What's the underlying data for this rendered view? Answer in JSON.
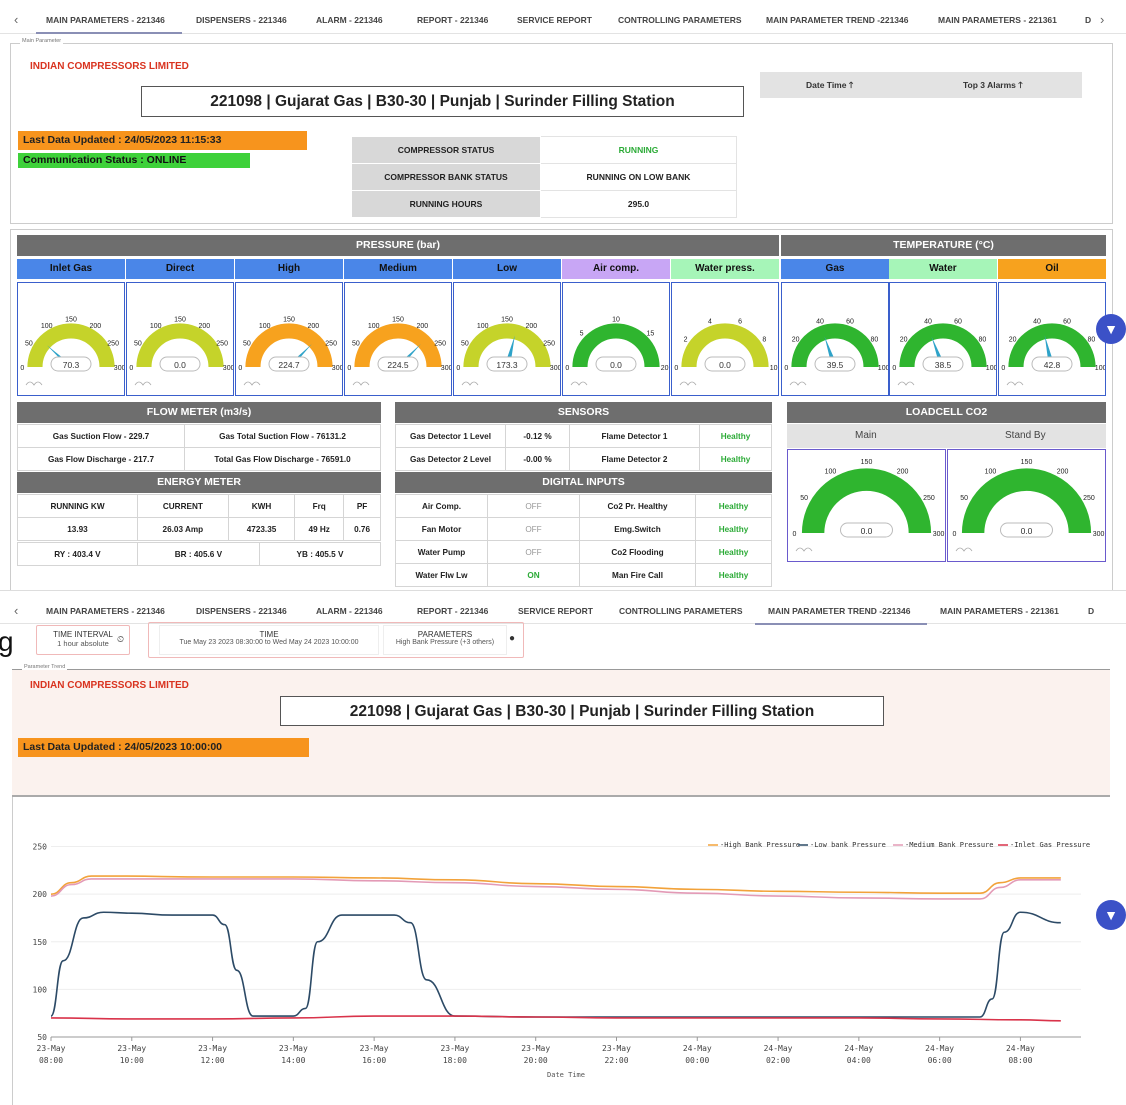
{
  "tabs_top": [
    "MAIN PARAMETERS - 221346",
    "DISPENSERS - 221346",
    "ALARM - 221346",
    "REPORT - 221346",
    "SERVICE REPORT",
    "CONTROLLING PARAMETERS",
    "MAIN PARAMETER TREND -221346",
    "MAIN PARAMETERS - 221361",
    "D"
  ],
  "tabs_bottom": [
    "MAIN PARAMETERS - 221346",
    "DISPENSERS - 221346",
    "ALARM - 221346",
    "REPORT - 221346",
    "SERVICE REPORT",
    "CONTROLLING PARAMETERS",
    "MAIN PARAMETER TREND -221346",
    "MAIN PARAMETERS - 221361",
    "D"
  ],
  "panel1": {
    "panel_label": "Main Parameter",
    "company": "INDIAN COMPRESSORS LIMITED",
    "station": "221098 | Gujarat Gas | B30-30 | Punjab | Surinder Filling Station",
    "last_updated": "Last Data Updated :  24/05/2023 11:15:33",
    "comm_status": "Communication Status : ONLINE",
    "date_time_btn": "Date Time",
    "top_alarms_btn": "Top 3 Alarms",
    "status": [
      {
        "label": "COMPRESSOR STATUS",
        "value": "RUNNING"
      },
      {
        "label": "COMPRESSOR BANK STATUS",
        "value": "RUNNING ON LOW BANK"
      },
      {
        "label": "RUNNING HOURS",
        "value": "295.0"
      }
    ]
  },
  "pressure": {
    "title": "PRESSURE (bar)",
    "gauges": [
      {
        "label": "Inlet Gas",
        "value": "70.3",
        "v": 70.3,
        "min": 0,
        "max": 300,
        "ticks": [
          "0",
          "50",
          "100",
          "150",
          "200",
          "250",
          "300"
        ],
        "color": "#c5d32a",
        "hcolor": "#4a86e8"
      },
      {
        "label": "Direct",
        "value": "0.0",
        "v": 0,
        "min": 0,
        "max": 300,
        "ticks": [
          "0",
          "50",
          "100",
          "150",
          "200",
          "250",
          "300"
        ],
        "color": "#c5d32a",
        "hcolor": "#4a86e8"
      },
      {
        "label": "High",
        "value": "224.7",
        "v": 224.7,
        "min": 0,
        "max": 300,
        "ticks": [
          "0",
          "50",
          "100",
          "150",
          "200",
          "250",
          "300"
        ],
        "color": "#f7a21e",
        "hcolor": "#4a86e8"
      },
      {
        "label": "Medium",
        "value": "224.5",
        "v": 224.5,
        "min": 0,
        "max": 300,
        "ticks": [
          "0",
          "50",
          "100",
          "150",
          "200",
          "250",
          "300"
        ],
        "color": "#f7a21e",
        "hcolor": "#4a86e8"
      },
      {
        "label": "Low",
        "value": "173.3",
        "v": 173.3,
        "min": 0,
        "max": 300,
        "ticks": [
          "0",
          "50",
          "100",
          "150",
          "200",
          "250",
          "300"
        ],
        "color": "#c5d32a",
        "hcolor": "#4a86e8"
      },
      {
        "label": "Air comp.",
        "value": "0.0",
        "v": 0,
        "min": 0,
        "max": 20,
        "ticks": [
          "0",
          "5",
          "10",
          "15",
          "20"
        ],
        "color": "#2fb52f",
        "hcolor": "#c8a6f5"
      },
      {
        "label": "Water press.",
        "value": "0.0",
        "v": 0,
        "min": 0,
        "max": 10,
        "ticks": [
          "0",
          "2",
          "4",
          "6",
          "8",
          "10"
        ],
        "color": "#c5d32a",
        "hcolor": "#a6f5b8"
      }
    ]
  },
  "temperature": {
    "title": "TEMPERATURE (°C)",
    "gauges": [
      {
        "label": "Gas",
        "value": "39.5",
        "v": 39.5,
        "min": 0,
        "max": 100,
        "ticks": [
          "0",
          "20",
          "40",
          "60",
          "80",
          "100"
        ],
        "color": "#2fb52f",
        "hcolor": "#4a86e8"
      },
      {
        "label": "Water",
        "value": "38.5",
        "v": 38.5,
        "min": 0,
        "max": 100,
        "ticks": [
          "0",
          "20",
          "40",
          "60",
          "80",
          "100"
        ],
        "color": "#2fb52f",
        "hcolor": "#a6f5b8"
      },
      {
        "label": "Oil",
        "value": "42.8",
        "v": 42.8,
        "min": 0,
        "max": 100,
        "ticks": [
          "0",
          "20",
          "40",
          "60",
          "80",
          "100"
        ],
        "color": "#2fb52f",
        "hcolor": "#f7a21e"
      }
    ]
  },
  "flow": {
    "title": "FLOW METER (m3/s)",
    "rows": [
      [
        "Gas Suction Flow - 229.7",
        "Gas Total Suction Flow - 76131.2"
      ],
      [
        "Gas Flow Discharge - 217.7",
        "Total Gas Flow Discharge - 76591.0"
      ]
    ]
  },
  "energy": {
    "title": "ENERGY METER",
    "headers": [
      "RUNNING KW",
      "CURRENT",
      "KWH",
      "Frq",
      "PF"
    ],
    "values": [
      "13.93",
      "26.03  Amp",
      "4723.35",
      "49 Hz",
      "0.76"
    ],
    "voltages": [
      "RY : 403.4  V",
      "BR : 405.6  V",
      "YB : 405.5 V"
    ]
  },
  "sensors": {
    "title": "SENSORS",
    "rows": [
      [
        "Gas Detector 1 Level",
        "-0.12 %",
        "Flame Detector 1",
        "Healthy"
      ],
      [
        "Gas Detector 2 Level",
        "-0.00 %",
        "Flame Detector 2",
        "Healthy"
      ]
    ]
  },
  "digital": {
    "title": "DIGITAL INPUTS",
    "rows": [
      [
        "Air Comp.",
        "OFF",
        "Co2 Pr. Healthy",
        "Healthy"
      ],
      [
        "Fan Motor",
        "OFF",
        "Emg.Switch",
        "Healthy"
      ],
      [
        "Water Pump",
        "OFF",
        "Co2 Flooding",
        "Healthy"
      ],
      [
        "Water Flw Lw",
        "ON",
        "Man Fire Call",
        "Healthy"
      ]
    ]
  },
  "loadcell": {
    "title": "LOADCELL CO2",
    "main_label": "Main",
    "standby_label": "Stand By",
    "gauges": [
      {
        "value": "0.0",
        "v": 0,
        "min": 0,
        "max": 300,
        "ticks": [
          "0",
          "50",
          "100",
          "150",
          "200",
          "250",
          "300"
        ]
      },
      {
        "value": "0.0",
        "v": 0,
        "min": 0,
        "max": 300,
        "ticks": [
          "0",
          "50",
          "100",
          "150",
          "200",
          "250",
          "300"
        ]
      }
    ]
  },
  "trend": {
    "time_interval_label": "TIME INTERVAL",
    "time_interval_value": "1 hour absolute",
    "time_label": "TIME",
    "time_value": "Tue May 23 2023 08:30:00 to Wed May 24 2023 10:00:00",
    "params_label": "PARAMETERS",
    "params_value": "High Bank Pressure (+3 others)",
    "side_char": "g",
    "panel_label": "Parameter Trend",
    "company": "INDIAN COMPRESSORS LIMITED",
    "station": "221098 | Gujarat Gas | B30-30 | Punjab | Surinder Filling Station",
    "last_updated": "Last Data Updated :  24/05/2023 10:00:00"
  },
  "chart_data": {
    "type": "line",
    "title": "",
    "xlabel": "Date Time",
    "ylabel": "",
    "ylim": [
      50,
      260
    ],
    "yticks": [
      "50",
      "100",
      "150",
      "200",
      "250"
    ],
    "xticks": [
      [
        "23-May",
        "08:00"
      ],
      [
        "23-May",
        "10:00"
      ],
      [
        "23-May",
        "12:00"
      ],
      [
        "23-May",
        "14:00"
      ],
      [
        "23-May",
        "16:00"
      ],
      [
        "23-May",
        "18:00"
      ],
      [
        "23-May",
        "20:00"
      ],
      [
        "23-May",
        "22:00"
      ],
      [
        "24-May",
        "00:00"
      ],
      [
        "24-May",
        "02:00"
      ],
      [
        "24-May",
        "04:00"
      ],
      [
        "24-May",
        "06:00"
      ],
      [
        "24-May",
        "08:00"
      ]
    ],
    "x_hours": [
      8,
      10,
      12,
      14,
      16,
      18,
      20,
      22,
      24,
      26,
      28,
      30,
      32
    ],
    "xlim_hours": [
      8,
      33.5
    ],
    "series": [
      {
        "name": "High Bank Pressure",
        "color": "#f2a23a",
        "x": [
          8,
          8.5,
          9,
          9.5,
          12,
          14,
          16,
          18,
          20,
          22,
          24,
          26,
          28,
          30,
          31,
          31.5,
          32,
          33
        ],
        "y": [
          200,
          212,
          219,
          219,
          218,
          218,
          217,
          215,
          211,
          208,
          205,
          203,
          202,
          201,
          201,
          212,
          217,
          217
        ]
      },
      {
        "name": "Low bank Pressure",
        "color": "#2c4a66",
        "x": [
          8,
          8.3,
          8.8,
          9.3,
          10,
          11,
          12,
          12.3,
          12.6,
          13,
          14,
          14.3,
          14.6,
          15.2,
          16,
          16.5,
          16.9,
          17.3,
          18,
          20,
          22,
          24,
          26,
          28,
          30,
          31,
          31.3,
          31.6,
          32,
          33
        ],
        "y": [
          72,
          130,
          175,
          181,
          180,
          178,
          178,
          168,
          120,
          72,
          72,
          80,
          150,
          178,
          178,
          178,
          170,
          110,
          72,
          71,
          71,
          71,
          71,
          71,
          71,
          71,
          90,
          160,
          181,
          170
        ]
      },
      {
        "name": "Medium Bank Pressure",
        "color": "#e39ab6",
        "x": [
          8,
          8.5,
          9,
          9.5,
          12,
          14,
          16,
          18,
          20,
          22,
          24,
          26,
          28,
          30,
          31,
          31.5,
          32,
          33
        ],
        "y": [
          198,
          210,
          216,
          216,
          216,
          216,
          214,
          212,
          208,
          205,
          201,
          198,
          196,
          195,
          195,
          207,
          215,
          215
        ]
      },
      {
        "name": "Inlet Gas Pressure",
        "color": "#d9334a",
        "x": [
          8,
          10,
          12,
          14,
          16,
          18,
          20,
          22,
          24,
          26,
          28,
          30,
          32,
          33
        ],
        "y": [
          70,
          69,
          69,
          70,
          72,
          72,
          71,
          70,
          70,
          70,
          70,
          69,
          68,
          67
        ]
      }
    ]
  }
}
